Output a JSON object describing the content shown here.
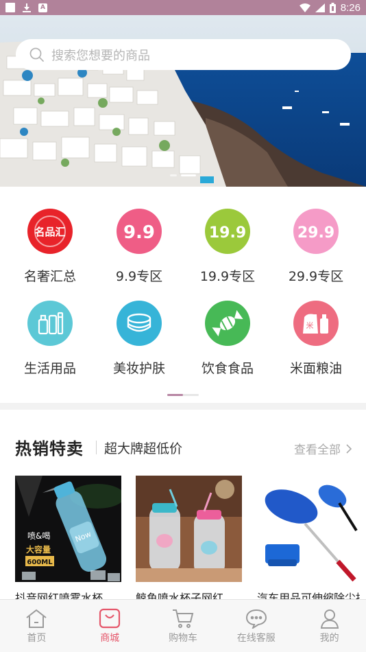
{
  "status_bar": {
    "time": "8:26",
    "left_icon_letter": "A"
  },
  "search": {
    "placeholder": "搜索您想要的商品"
  },
  "banner": {
    "page_count": 2,
    "active_page": 2
  },
  "categories": [
    {
      "label": "名奢汇总",
      "icon": "luxury-logo-icon",
      "icon_text": "名品汇",
      "color": "#e8232a"
    },
    {
      "label": "9.9专区",
      "icon": "price-9-9-icon",
      "icon_text": "9.9",
      "color": "#ef5d86"
    },
    {
      "label": "19.9专区",
      "icon": "price-19-9-icon",
      "icon_text": "19.9",
      "color": "#9bc93b"
    },
    {
      "label": "29.9专区",
      "icon": "price-29-9-icon",
      "icon_text": "29.9",
      "color": "#f59bc7"
    },
    {
      "label": "生活用品",
      "icon": "daily-goods-icon",
      "color": "#5cc8d6"
    },
    {
      "label": "美妆护肤",
      "icon": "cosmetics-icon",
      "color": "#36b4d8"
    },
    {
      "label": "饮食食品",
      "icon": "candy-food-icon",
      "color": "#47b956"
    },
    {
      "label": "米面粮油",
      "icon": "rice-grain-icon",
      "icon_text": "米",
      "color": "#ee6c80"
    }
  ],
  "category_pages": {
    "count": 2,
    "active": 1
  },
  "hot_sale": {
    "title": "热销特卖",
    "subtitle": "超大牌超低价",
    "more": "查看全部",
    "products": [
      {
        "name": "抖音网红喷雾水杯",
        "badge_top": "喷&喝",
        "badge_mid": "大容量",
        "badge_bottom": "600ML",
        "brand_on_bottle": "Now"
      },
      {
        "name": "鲸鱼喷水杯子网红"
      },
      {
        "name": "汽车用品可伸缩除尘掸"
      }
    ]
  },
  "tabs": [
    {
      "label": "首页",
      "icon": "home-icon",
      "active": false
    },
    {
      "label": "商城",
      "icon": "shopping-bag-icon",
      "active": true
    },
    {
      "label": "购物车",
      "icon": "cart-icon",
      "active": false
    },
    {
      "label": "在线客服",
      "icon": "chat-icon",
      "active": false
    },
    {
      "label": "我的",
      "icon": "user-icon",
      "active": false
    }
  ],
  "colors": {
    "accent": "#e5566a",
    "status_bar": "#b1829a",
    "pager": "#b784a2"
  }
}
